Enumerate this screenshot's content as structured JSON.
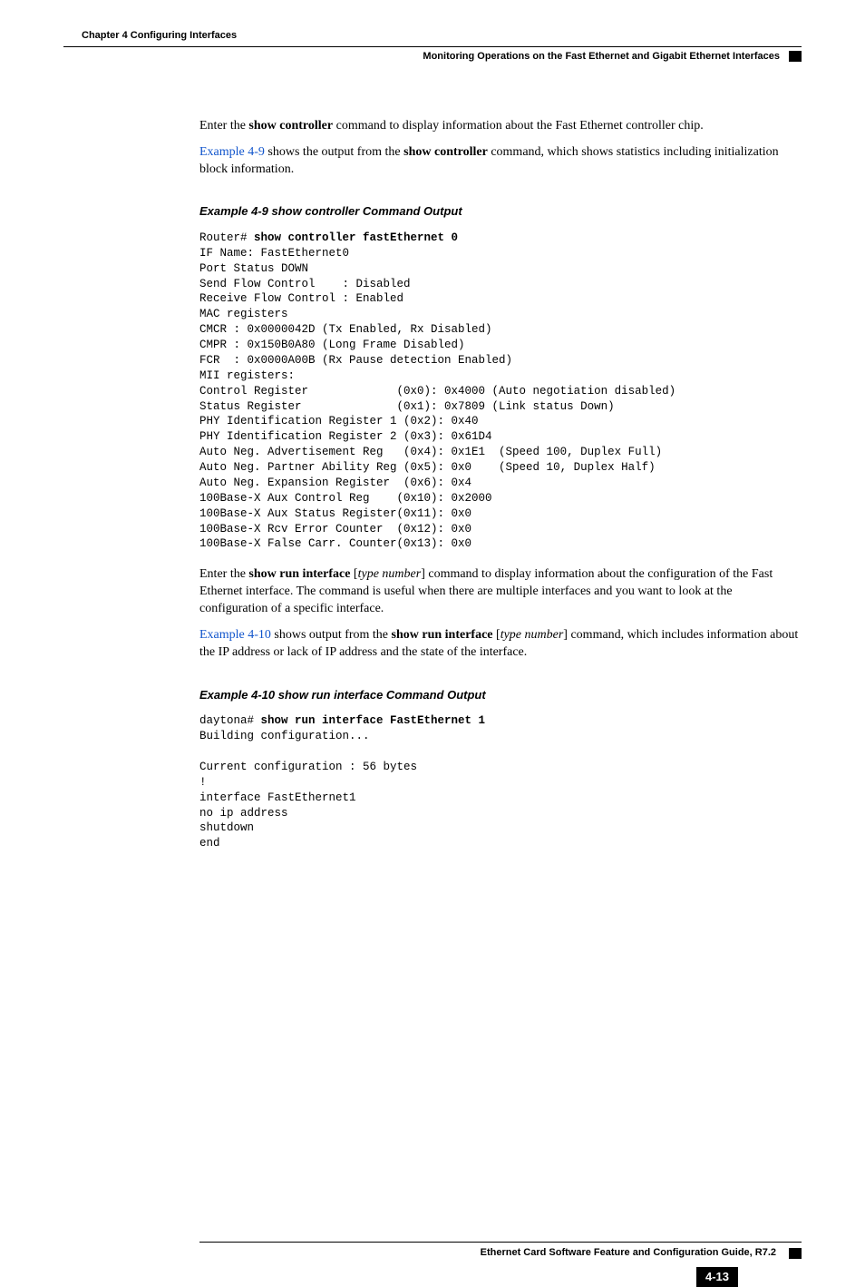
{
  "header": {
    "chapter": "Chapter 4 Configuring Interfaces",
    "section": "Monitoring Operations on the Fast Ethernet and Gigabit Ethernet Interfaces"
  },
  "body": {
    "para1_a": "Enter the ",
    "para1_cmd": "show controller",
    "para1_b": " command to display information about the Fast Ethernet controller chip.",
    "para2_link": "Example 4-9",
    "para2_a": " shows the output from the ",
    "para2_cmd": "show controller",
    "para2_b": " command, which shows statistics including initialization block information.",
    "example1_title": "Example 4-9    show controller Command Output",
    "code1_prompt": "Router# ",
    "code1_cmd": "show controller fastEthernet 0",
    "code1_body": "IF Name: FastEthernet0\nPort Status DOWN\nSend Flow Control    : Disabled\nReceive Flow Control : Enabled\nMAC registers\nCMCR : 0x0000042D (Tx Enabled, Rx Disabled)\nCMPR : 0x150B0A80 (Long Frame Disabled)\nFCR  : 0x0000A00B (Rx Pause detection Enabled)\nMII registers:\nControl Register             (0x0): 0x4000 (Auto negotiation disabled)\nStatus Register              (0x1): 0x7809 (Link status Down)\nPHY Identification Register 1 (0x2): 0x40\nPHY Identification Register 2 (0x3): 0x61D4\nAuto Neg. Advertisement Reg   (0x4): 0x1E1  (Speed 100, Duplex Full)\nAuto Neg. Partner Ability Reg (0x5): 0x0    (Speed 10, Duplex Half)\nAuto Neg. Expansion Register  (0x6): 0x4\n100Base-X Aux Control Reg    (0x10): 0x2000\n100Base-X Aux Status Register(0x11): 0x0\n100Base-X Rcv Error Counter  (0x12): 0x0\n100Base-X False Carr. Counter(0x13): 0x0",
    "para3_a": "Enter the ",
    "para3_cmd": "show run interface",
    "para3_b": " [",
    "para3_arg": "type number",
    "para3_c": "] command to display information about the configuration of the Fast Ethernet interface. The command is useful when there are multiple interfaces and you want to look at the configuration of a specific interface.",
    "para4_link": "Example 4-10",
    "para4_a": " shows output from the ",
    "para4_cmd": "show run interface",
    "para4_b": " [",
    "para4_arg": "type number",
    "para4_c": "] command, which includes information about the IP address or lack of IP address and the state of the interface.",
    "example2_title": "Example 4-10   show run interface Command Output",
    "code2_prompt": "daytona# ",
    "code2_cmd": "show run interface FastEthernet 1",
    "code2_body": "Building configuration...\n\nCurrent configuration : 56 bytes\n!\ninterface FastEthernet1\nno ip address\nshutdown\nend"
  },
  "footer": {
    "guide": "Ethernet Card Software Feature and Configuration Guide, R7.2",
    "page": "4-13"
  }
}
